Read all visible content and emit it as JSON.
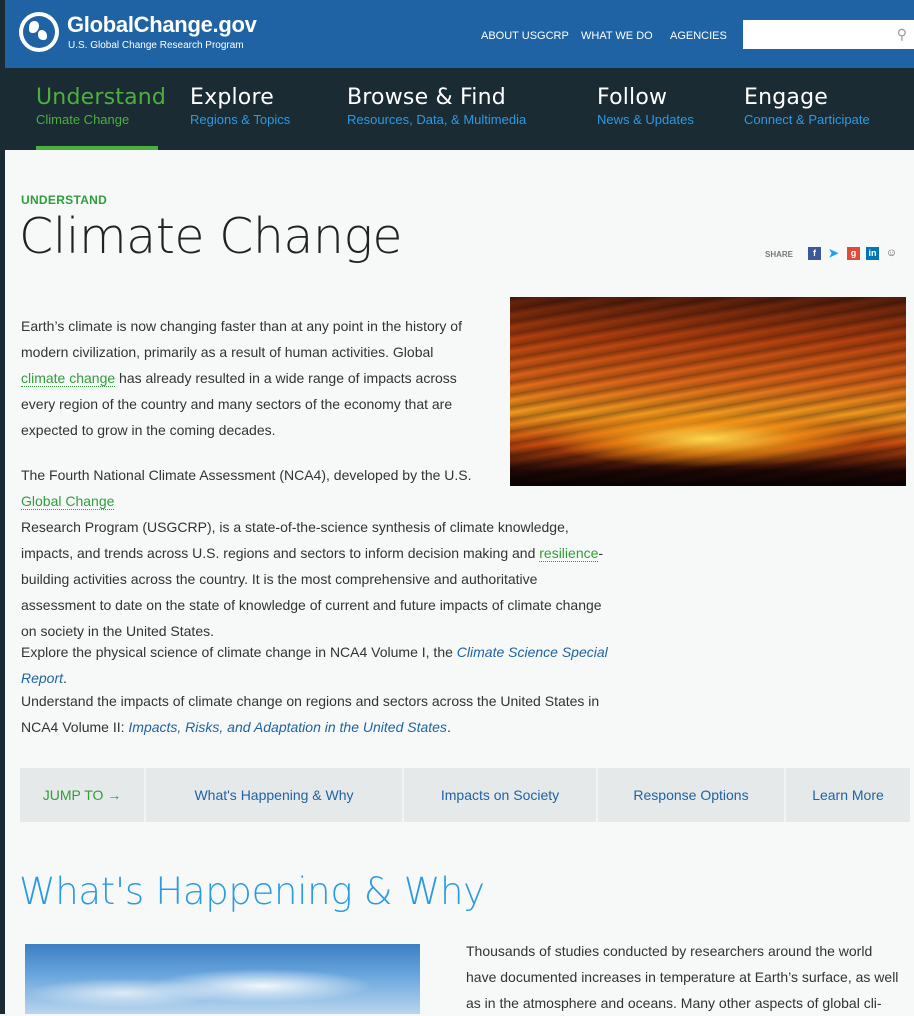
{
  "header": {
    "site_name": "GlobalChange.gov",
    "site_subtitle": "U.S. Global Change Research Program",
    "util_links": [
      "ABOUT USGCRP",
      "WHAT WE DO",
      "AGENCIES"
    ],
    "search_placeholder": ""
  },
  "nav": {
    "items": [
      {
        "title": "Understand",
        "sub": "Climate Change",
        "active": true
      },
      {
        "title": "Explore",
        "sub": "Regions & Topics"
      },
      {
        "title": "Browse & Find",
        "sub": "Resources, Data, & Multimedia"
      },
      {
        "title": "Follow",
        "sub": "News & Updates"
      },
      {
        "title": "Engage",
        "sub": "Connect & Participate"
      }
    ]
  },
  "page": {
    "eyebrow": "UNDERSTAND",
    "title": "Climate Change",
    "share_label": "SHARE"
  },
  "intro": {
    "p1_a": "Earth’s climate is now changing faster than at any point in the history of modern civilization, primarily as a result of human activities. Global ",
    "p1_link": "climate change",
    "p1_b": " has already resulted in a wide range of impacts across every region of the country and many sectors of the economy that are expected to grow in the coming decades.",
    "p2_a": "The Fourth National Climate Assessment (NCA4), developed by the U.S. ",
    "p2_link1": "Global Change",
    "p2_b": " Research Program (USGCRP), is a state-of-the-science synthesis of climate knowledge, impacts, and trends across U.S. regions and sectors to inform decision making and ",
    "p2_link2": "resilience",
    "p2_c": "-building activities across the country. It is the most comprehensive and authoritative assessment to date on the state of knowledge of current and future impacts of climate change on society in the United States.",
    "p3_a": "Explore the physical science of climate change in NCA4 Volume I, the ",
    "p3_link": "Climate Science Special Report",
    "p3_b": ".",
    "p4_a": "Understand the impacts of climate change on regions and sectors across the United States in NCA4 Volume II: ",
    "p4_link": "Impacts, Risks, and Adaptation in the United States",
    "p4_b": "."
  },
  "jump": {
    "label": "JUMP TO →",
    "links": [
      "What's Happening & Why",
      "Impacts on Society",
      "Response Options",
      "Learn More"
    ]
  },
  "section": {
    "title": "What's Happening & Why",
    "para": "Thousands of studies conducted by researchers around the world have documented increases in temperature at Earth’s surface, as well as in the atmosphere and oceans. Many other aspects of global cli-"
  },
  "colors": {
    "brand_blue": "#1f63a4",
    "nav_dark": "#1b2b33",
    "accent_green": "#4caf3f",
    "link_blue": "#2b9ae3"
  }
}
